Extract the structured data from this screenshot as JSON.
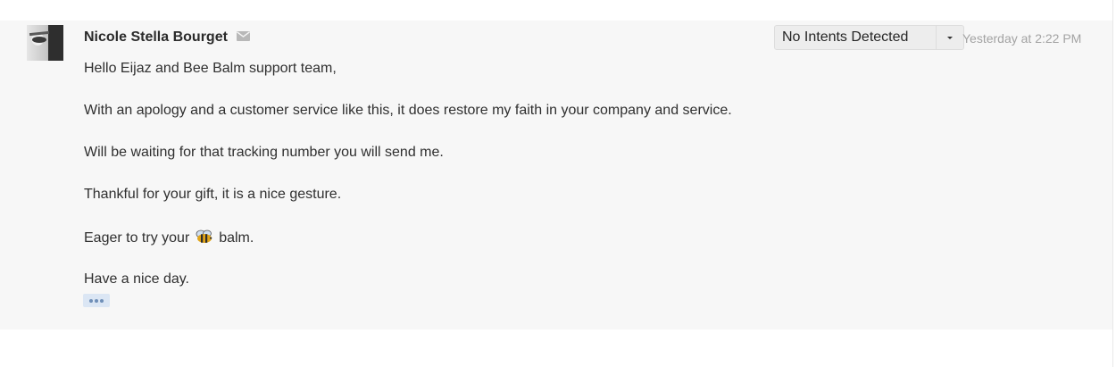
{
  "message": {
    "sender_name": "Nicole Stella Bourget",
    "sender_icon": "envelope-icon",
    "avatar": "sender-avatar",
    "intent_label": "No Intents Detected",
    "intent_caret_icon": "caret-down-icon",
    "timestamp": "Yesterday at 2:22 PM",
    "body": {
      "line1": "Hello Eijaz and Bee Balm support team,",
      "line2": "With an apology and a customer service like this, it does restore my faith in your company and service.",
      "line3": "Will be waiting for that tracking number you will send me.",
      "line4": "Thankful for your gift, it is a nice gesture.",
      "line5_before": "Eager to try your",
      "line5_emoji": "bee-emoji-icon",
      "line5_after": "balm.",
      "line6": "Have a nice day."
    },
    "more_icon": "ellipsis-icon"
  },
  "colors": {
    "card_background": "#f7f7f7",
    "more_button_background": "#dbe6f4",
    "timestamp": "#a3a3a3"
  }
}
